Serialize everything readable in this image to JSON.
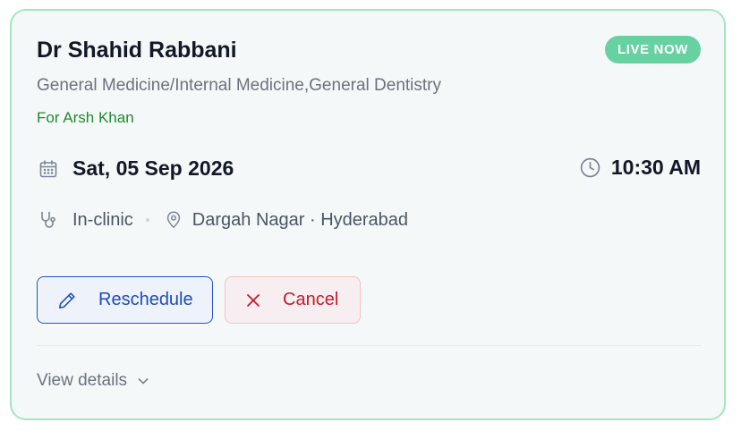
{
  "appointment": {
    "doctor_name": "Dr Shahid Rabbani",
    "status_badge": "LIVE NOW",
    "specialty": "General Medicine/Internal Medicine,General Dentistry",
    "patient_line": "For Arsh Khan",
    "date": "Sat, 05 Sep 2026",
    "time": "10:30 AM",
    "mode": "In-clinic",
    "location": "Dargah Nagar · Hyderabad"
  },
  "actions": {
    "reschedule_label": "Reschedule",
    "cancel_label": "Cancel",
    "view_details_label": "View details"
  },
  "icons": {
    "date": "calendar-icon",
    "time": "clock-icon",
    "mode": "stethoscope-icon",
    "location": "map-pin-icon",
    "reschedule": "pencil-icon",
    "cancel": "close-icon",
    "expand": "chevron-down-icon"
  },
  "colors": {
    "card_border": "#9fe7c2",
    "live_badge": "#67d1a2",
    "patient_text": "#1f8a2c",
    "reschedule_accent": "#2453c7",
    "cancel_accent": "#c8192a"
  }
}
